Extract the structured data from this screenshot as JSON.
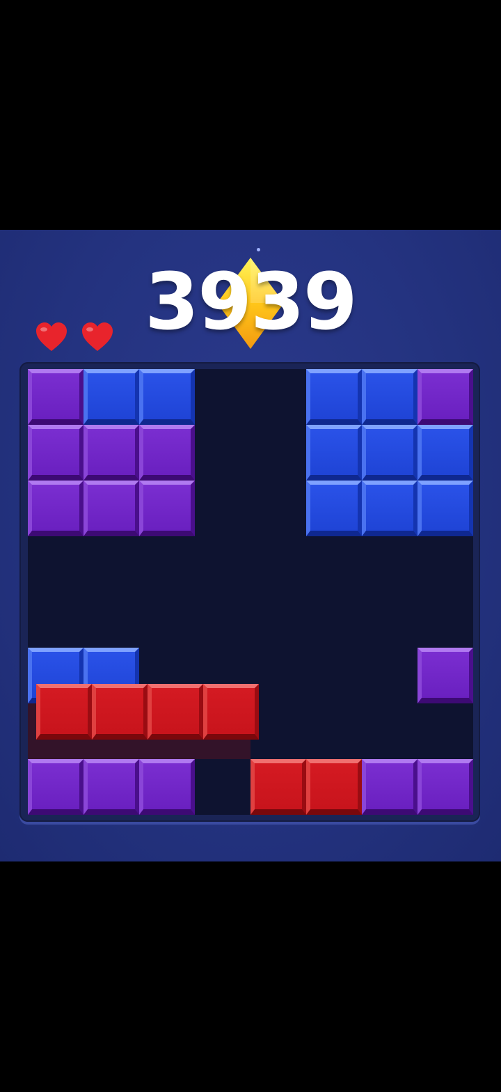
{
  "score": "3939",
  "lives": {
    "count": 2,
    "icon": "heart-icon",
    "color": "#e8242c"
  },
  "colors": {
    "background": "#243380",
    "board": "#0e1330",
    "purple": "#6a20c0",
    "blue": "#1f44d6",
    "red": "#c8141c",
    "gem": "#ffc21a"
  },
  "board": {
    "columns": 8,
    "rows": 8,
    "cells": [
      {
        "row": 0,
        "col": 0,
        "color": "purple"
      },
      {
        "row": 0,
        "col": 1,
        "color": "blue"
      },
      {
        "row": 0,
        "col": 2,
        "color": "blue"
      },
      {
        "row": 0,
        "col": 5,
        "color": "blue"
      },
      {
        "row": 0,
        "col": 6,
        "color": "blue"
      },
      {
        "row": 0,
        "col": 7,
        "color": "purple"
      },
      {
        "row": 1,
        "col": 0,
        "color": "purple"
      },
      {
        "row": 1,
        "col": 1,
        "color": "purple"
      },
      {
        "row": 1,
        "col": 2,
        "color": "purple"
      },
      {
        "row": 1,
        "col": 5,
        "color": "blue"
      },
      {
        "row": 1,
        "col": 6,
        "color": "blue"
      },
      {
        "row": 1,
        "col": 7,
        "color": "blue"
      },
      {
        "row": 2,
        "col": 0,
        "color": "purple"
      },
      {
        "row": 2,
        "col": 1,
        "color": "purple"
      },
      {
        "row": 2,
        "col": 2,
        "color": "purple"
      },
      {
        "row": 2,
        "col": 5,
        "color": "blue"
      },
      {
        "row": 2,
        "col": 6,
        "color": "blue"
      },
      {
        "row": 2,
        "col": 7,
        "color": "blue"
      },
      {
        "row": 5,
        "col": 0,
        "color": "blue"
      },
      {
        "row": 5,
        "col": 1,
        "color": "blue"
      },
      {
        "row": 5,
        "col": 7,
        "color": "purple"
      },
      {
        "row": 7,
        "col": 0,
        "color": "purple"
      },
      {
        "row": 7,
        "col": 1,
        "color": "purple"
      },
      {
        "row": 7,
        "col": 2,
        "color": "purple"
      },
      {
        "row": 7,
        "col": 4,
        "color": "red"
      },
      {
        "row": 7,
        "col": 5,
        "color": "red"
      },
      {
        "row": 7,
        "col": 6,
        "color": "purple"
      },
      {
        "row": 7,
        "col": 7,
        "color": "purple"
      }
    ],
    "falling_piece": {
      "color": "red",
      "length": 4,
      "row": 6,
      "col": 0
    }
  }
}
